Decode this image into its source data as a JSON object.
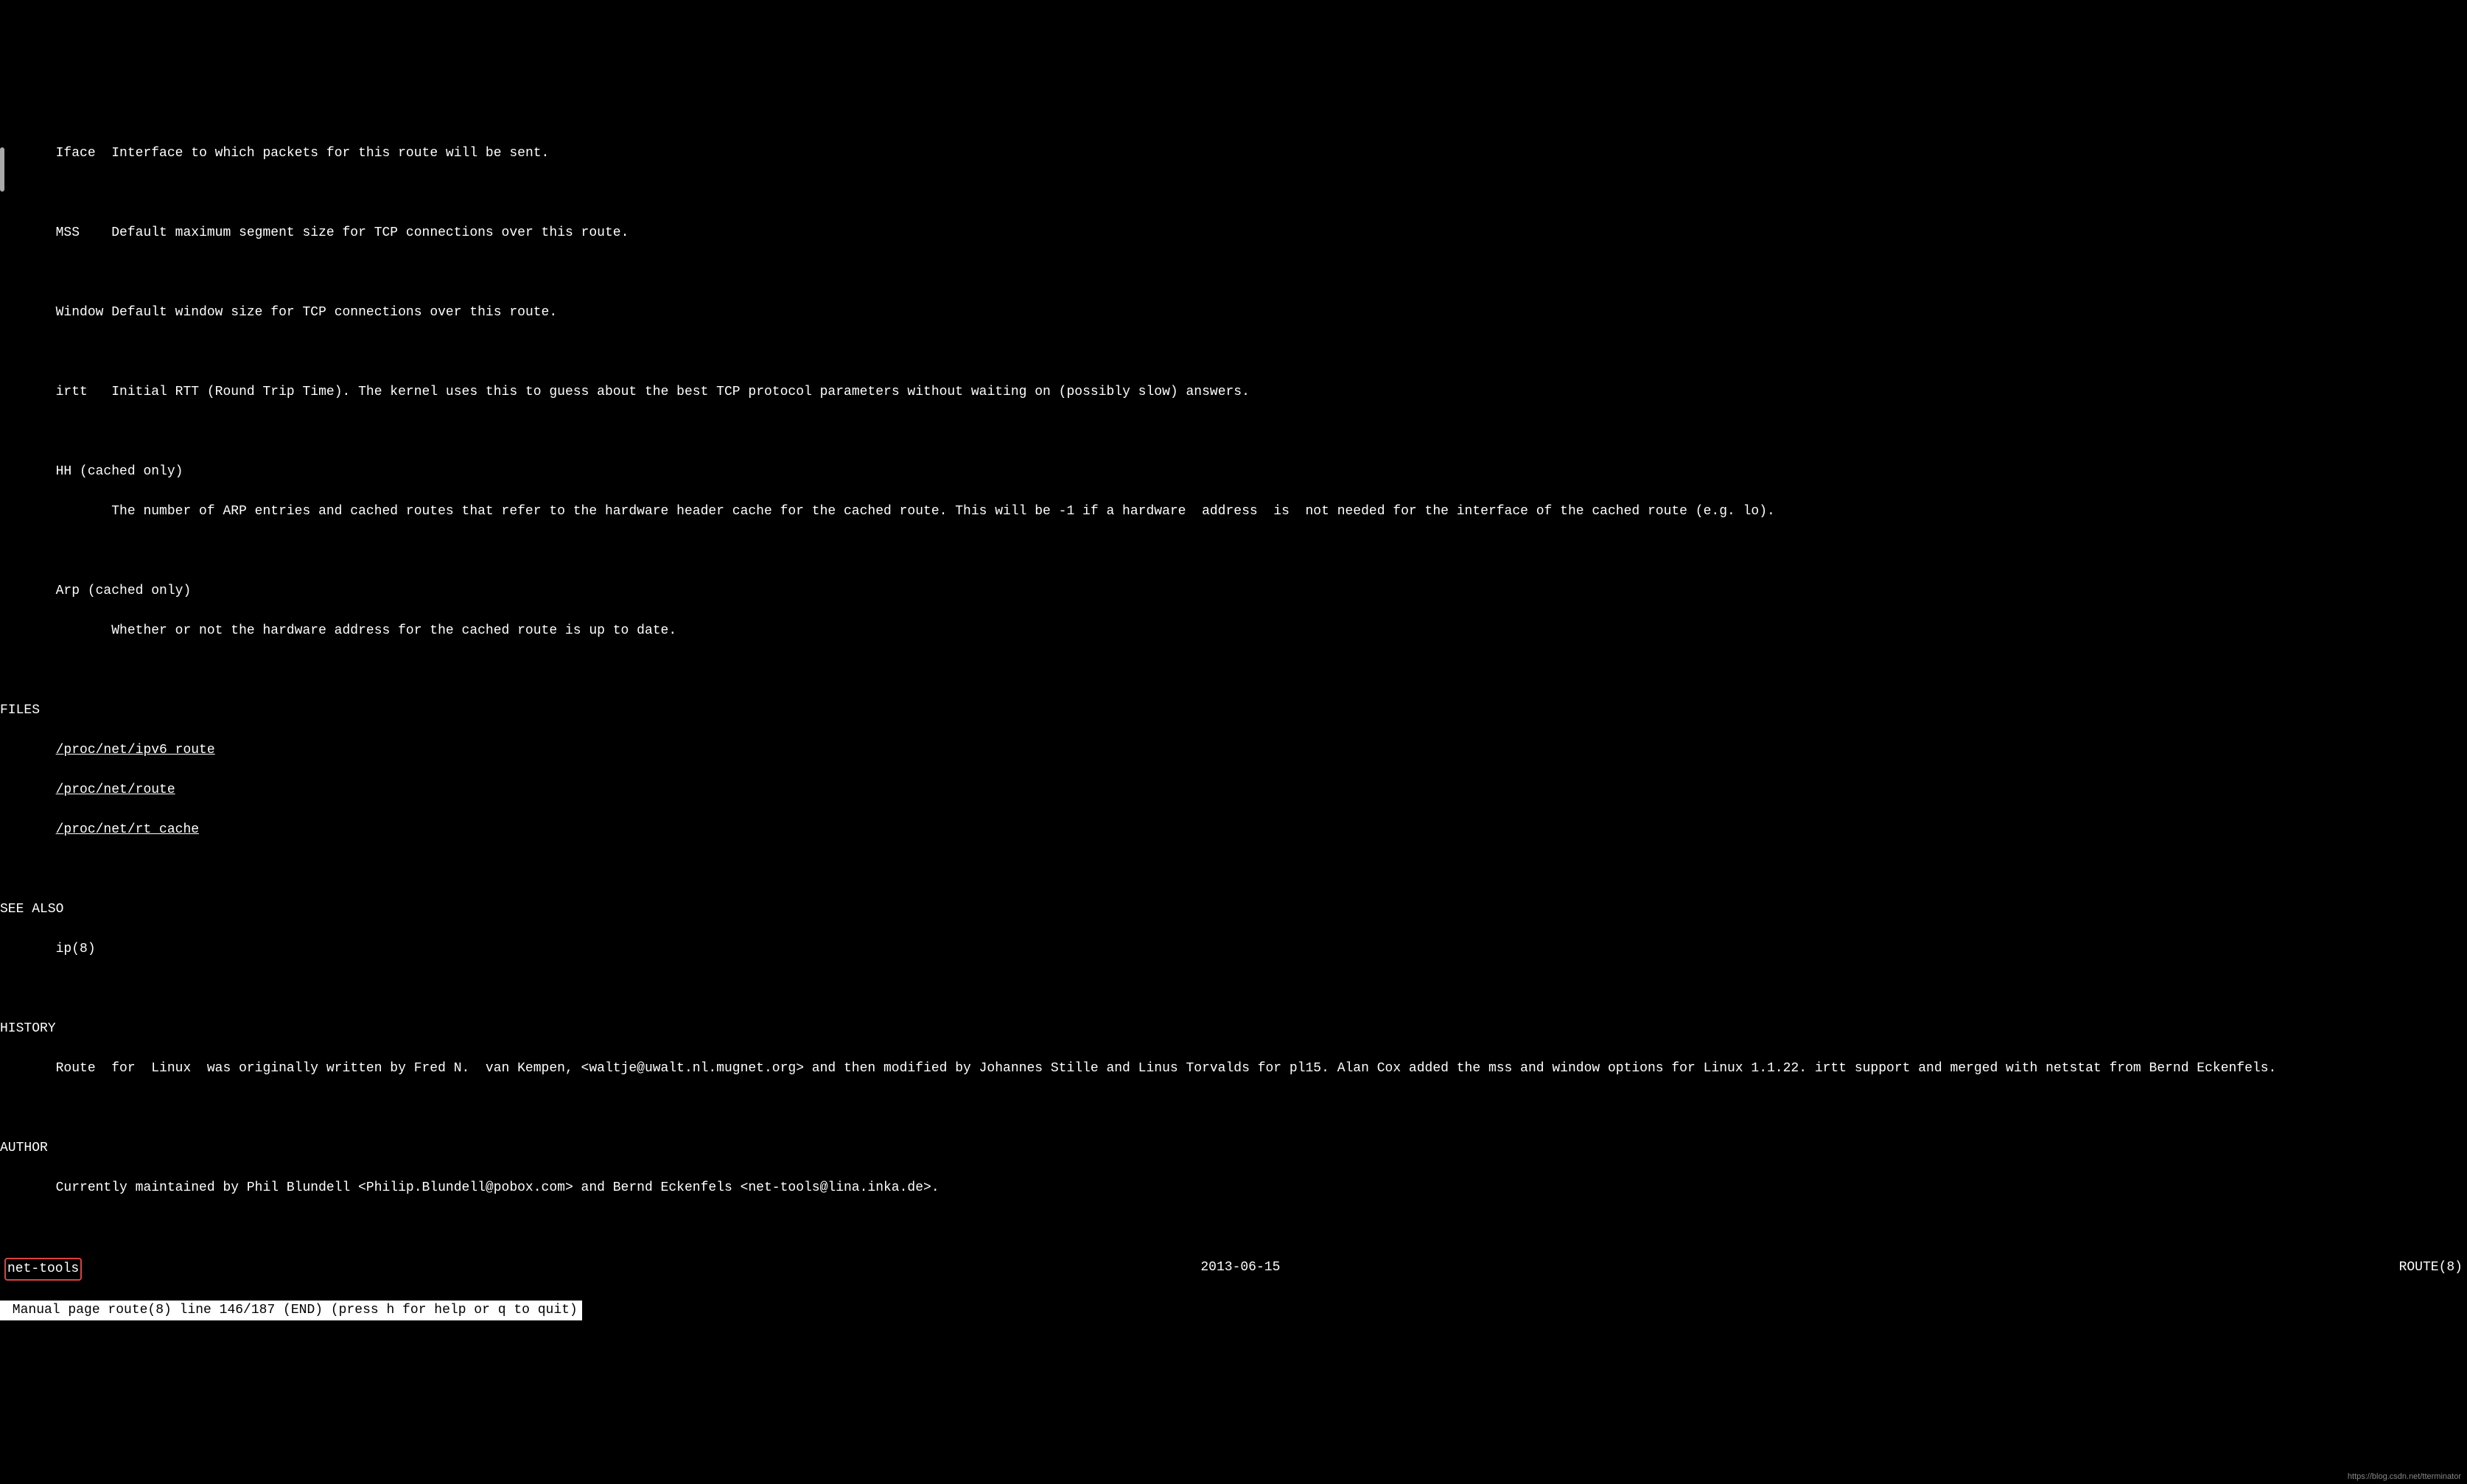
{
  "entries": {
    "iface": {
      "term": "Iface",
      "desc": "Interface to which packets for this route will be sent."
    },
    "mss": {
      "term": "MSS",
      "desc": "Default maximum segment size for TCP connections over this route."
    },
    "window": {
      "term": "Window",
      "desc": "Default window size for TCP connections over this route."
    },
    "irtt": {
      "term": "irtt",
      "desc": "Initial RTT (Round Trip Time). The kernel uses this to guess about the best TCP protocol parameters without waiting on (possibly slow) answers."
    },
    "hh": {
      "term": "HH (cached only)",
      "desc": "The number of ARP entries and cached routes that refer to the hardware header cache for the cached route. This will be -1 if a hardware  address  is  not needed for the interface of the cached route (e.g. lo)."
    },
    "arp": {
      "term": "Arp (cached only)",
      "desc": "Whether or not the hardware address for the cached route is up to date."
    }
  },
  "sections": {
    "files": {
      "heading": "FILES",
      "items": [
        "/proc/net/ipv6_route",
        "/proc/net/route",
        "/proc/net/rt_cache"
      ]
    },
    "see_also": {
      "heading": "SEE ALSO",
      "text": "ip(8)"
    },
    "history": {
      "heading": "HISTORY",
      "text": "Route  for  Linux  was originally written by Fred N.  van Kempen, <waltje@uwalt.nl.mugnet.org> and then modified by Johannes Stille and Linus Torvalds for pl15. Alan Cox added the mss and window options for Linux 1.1.22. irtt support and merged with netstat from Bernd Eckenfels."
    },
    "author": {
      "heading": "AUTHOR",
      "text": "Currently maintained by Phil Blundell <Philip.Blundell@pobox.com> and Bernd Eckenfels <net-tools@lina.inka.de>."
    }
  },
  "footer": {
    "left": "net-tools",
    "center": "2013-06-15",
    "right": "ROUTE(8)"
  },
  "status": " Manual page route(8) line 146/187 (END) (press h for help or q to quit)",
  "watermark": "https://blog.csdn.net/tterminator"
}
